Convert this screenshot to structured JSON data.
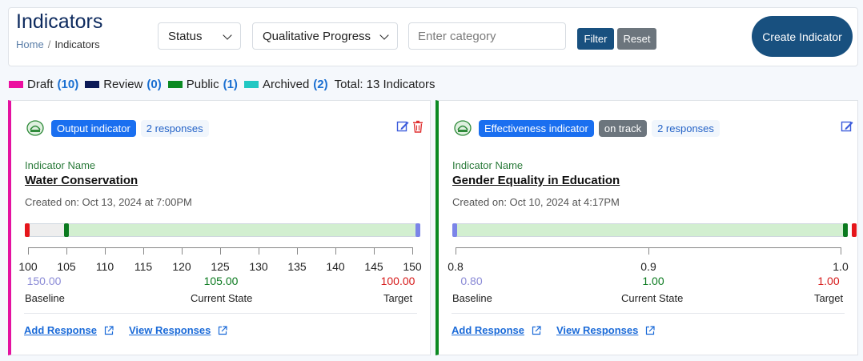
{
  "header": {
    "title": "Indicators",
    "breadcrumb": {
      "home": "Home",
      "separator": "/",
      "current": "Indicators"
    },
    "status_select": {
      "value": "Status"
    },
    "progress_select": {
      "value": "Qualitative Progress"
    },
    "category_input": {
      "placeholder": "Enter category",
      "value": ""
    },
    "filter_label": "Filter",
    "reset_label": "Reset",
    "create_label": "Create Indicator"
  },
  "legend": {
    "items": [
      {
        "label": "Draft",
        "count": "(10)",
        "color": "#ec0fa0"
      },
      {
        "label": "Review",
        "count": "(0)",
        "color": "#0c1a57"
      },
      {
        "label": "Public",
        "count": "(1)",
        "color": "#0b8a22"
      },
      {
        "label": "Archived",
        "count": "(2)",
        "color": "#21c8c3"
      }
    ],
    "total": "Total: 13 Indicators"
  },
  "cards": [
    {
      "accent": "#e412a0",
      "type_badge": "Output indicator",
      "responses_badge": "2 responses",
      "name_label": "Indicator Name",
      "name": "Water Conservation",
      "created": "Created on: Oct 13, 2024 at 7:00PM",
      "axis_ticks": [
        "100",
        "105",
        "110",
        "115",
        "120",
        "125",
        "130",
        "135",
        "140",
        "145",
        "150"
      ],
      "baseline_value": "150.00",
      "current_value": "105.00",
      "target_value": "100.00",
      "baseline_caption": "Baseline",
      "current_caption": "Current State",
      "target_caption": "Target",
      "add_response": "Add Response",
      "view_responses": "View Responses",
      "icons": [
        "edit-icon",
        "trash-icon",
        "external-link-icon"
      ]
    },
    {
      "accent": "#0b8a22",
      "type_badge": "Effectiveness indicator",
      "status_badge": "on track",
      "responses_badge": "2 responses",
      "name_label": "Indicator Name",
      "name": "Gender Equality in Education",
      "created": "Created on: Oct 10, 2024 at 4:17PM",
      "axis_ticks": [
        "0.8",
        "0.9",
        "1.0"
      ],
      "baseline_value": "0.80",
      "current_value": "1.00",
      "target_value": "1.00",
      "baseline_caption": "Baseline",
      "current_caption": "Current State",
      "target_caption": "Target",
      "add_response": "Add Response",
      "view_responses": "View Responses",
      "icons": [
        "edit-icon",
        "external-link-icon"
      ]
    }
  ]
}
